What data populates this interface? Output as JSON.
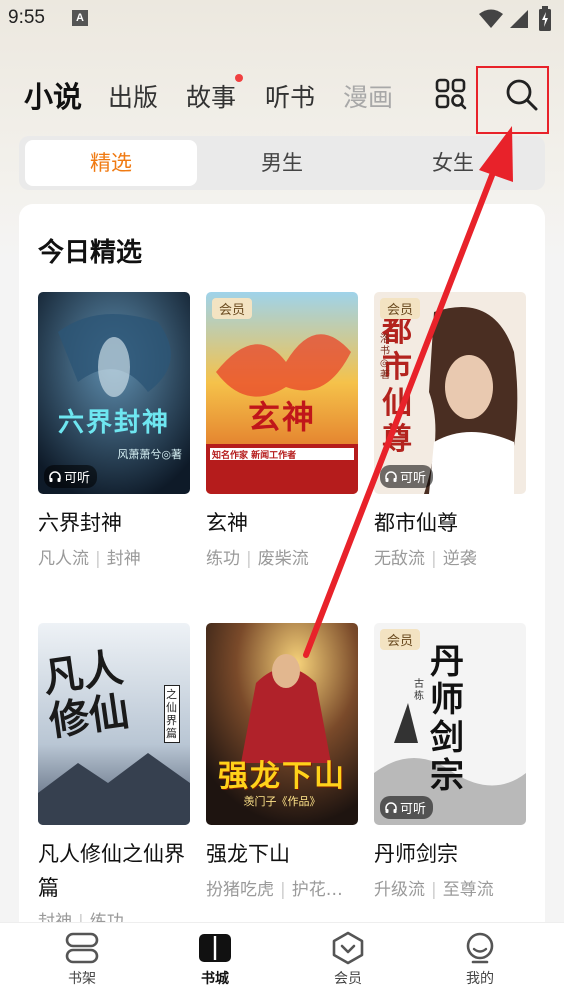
{
  "status_bar": {
    "time": "9:55",
    "notif_letter": "A"
  },
  "top_nav": {
    "tabs": [
      {
        "label": "小说",
        "active": true
      },
      {
        "label": "出版"
      },
      {
        "label": "故事",
        "dot": true
      },
      {
        "label": "听书"
      },
      {
        "label": "漫画"
      }
    ]
  },
  "segment": {
    "items": [
      "精选",
      "男生",
      "女生"
    ],
    "active": "精选"
  },
  "section": {
    "title": "今日精选"
  },
  "books": [
    {
      "title": "六界封神",
      "tags": [
        "凡人流",
        "封神"
      ],
      "member": "",
      "listen": "可听",
      "cover_text": "六界封神",
      "cover_sub": "风萧萧兮◎著"
    },
    {
      "title": "玄神",
      "tags": [
        "练功",
        "废柴流"
      ],
      "member": "会员",
      "listen": "",
      "cover_text": "玄神",
      "cover_sub": "知名作家 新闻工作者"
    },
    {
      "title": "都市仙尊",
      "tags": [
        "无敌流",
        "逆袭"
      ],
      "member": "会员",
      "listen": "可听",
      "cover_text": "都市仙尊",
      "cover_sub": "洛书◎著"
    },
    {
      "title": "凡人修仙之仙界篇",
      "tags": [
        "封神",
        "练功"
      ],
      "member": "",
      "listen": "",
      "cover_text": "凡人修仙",
      "cover_sub": "之仙界篇"
    },
    {
      "title": "强龙下山",
      "tags": [
        "扮猪吃虎",
        "护花…"
      ],
      "member": "",
      "listen": "",
      "cover_text": "强龙下山",
      "cover_sub": "羡门子《作品》"
    },
    {
      "title": "丹师剑宗",
      "tags": [
        "升级流",
        "至尊流"
      ],
      "member": "会员",
      "listen": "可听",
      "cover_text": "丹师剑宗",
      "cover_sub": "古栋"
    }
  ],
  "bottom_nav": {
    "items": [
      {
        "label": "书架",
        "icon": "bookshelf-icon"
      },
      {
        "label": "书城",
        "icon": "bookstore-icon",
        "active": true
      },
      {
        "label": "会员",
        "icon": "vip-icon"
      },
      {
        "label": "我的",
        "icon": "profile-icon"
      }
    ]
  },
  "colors": {
    "accent": "#f07a12",
    "highlight": "#e8222a",
    "dot": "#f04040"
  }
}
